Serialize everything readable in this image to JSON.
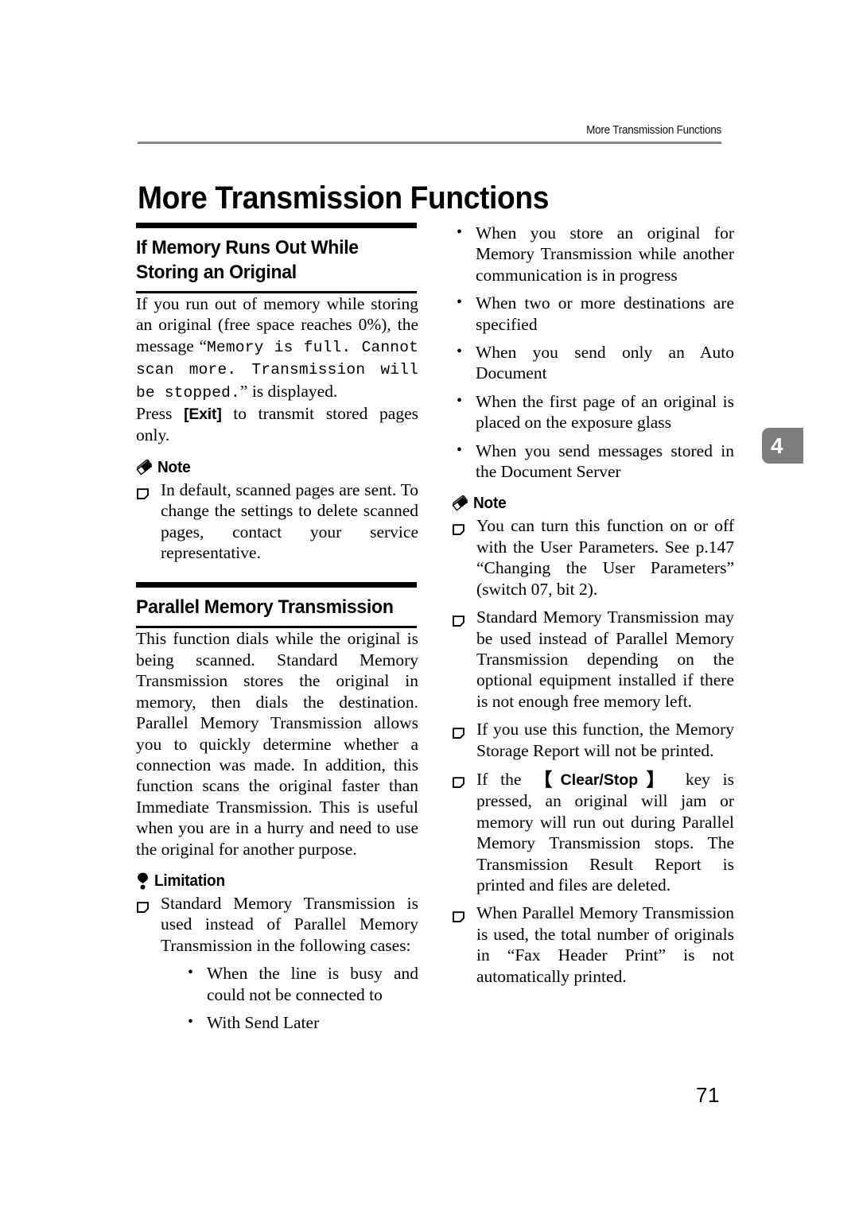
{
  "header": {
    "running_title": "More Transmission Functions"
  },
  "chapter": {
    "title": "More Transmission Functions",
    "tab_number": "4"
  },
  "left_column": {
    "section1": {
      "heading_line1": "If Memory Runs Out While",
      "heading_line2": "Storing an Original",
      "intro_part1": "If you run out of memory while storing an original (free space reaches 0%), the message “",
      "intro_mono": "Memory is full. Cannot scan more. Transmission will be stopped.",
      "intro_part2": "” is displayed.",
      "press_part1": "Press ",
      "press_key": "[Exit]",
      "press_part2": " to transmit stored pages only.",
      "note_label": "Note",
      "note_items": [
        "In default, scanned pages are sent. To change the settings to delete scanned pages, contact your service representative."
      ]
    },
    "section2": {
      "heading": "Parallel Memory Transmission",
      "body": "This function dials while the original is being scanned. Standard Memory Transmission stores the original in memory, then dials the destination. Parallel Memory Transmission allows you to quickly determine whether a connection was made. In addition, this function scans the original faster than Immediate Transmission. This is useful when you are in a hurry and need to use the original for another purpose.",
      "limitation_label": "Limitation",
      "limitation_items": [
        "Standard Memory Transmission is used instead of Parallel Memory Transmission in the following cases:"
      ],
      "limitation_bullets": [
        "When the line is busy and could not be connected to",
        "With Send Later"
      ]
    }
  },
  "right_column": {
    "top_bullets": [
      "When you store an original for Memory Transmission while another communication is in progress",
      "When two or more destinations are specified",
      "When you send only an Auto Document",
      "When the first page of an original is placed on the exposure glass",
      "When you send messages stored in the Document Server"
    ],
    "note_label": "Note",
    "note_items": [
      "You can turn this function on or off with the User Parameters. See p.147 “Changing the User Parameters” (switch 07, bit 2).",
      "Standard Memory Transmission may be used instead of Parallel Memory Transmission depending on the optional equipment installed if there is not enough free memory left.",
      "If you use this function, the Memory Storage Report will not be printed."
    ],
    "note_item_clearstop": {
      "part1": "If the ",
      "key": "Clear/Stop",
      "part2": " key is pressed, an original will jam or memory will run out during Parallel Memory Transmission stops. The Transmission Result Report is printed and files are deleted."
    },
    "note_item_last": "When Parallel Memory Transmission is used, the total number of originals in “Fax Header Print” is not automatically printed."
  },
  "footer": {
    "page_number": "71"
  },
  "colors": {
    "text": "#000000",
    "header_rule": "#8a8a8a",
    "tab_background": "#7d7d7d",
    "tab_text": "#ffffff"
  }
}
